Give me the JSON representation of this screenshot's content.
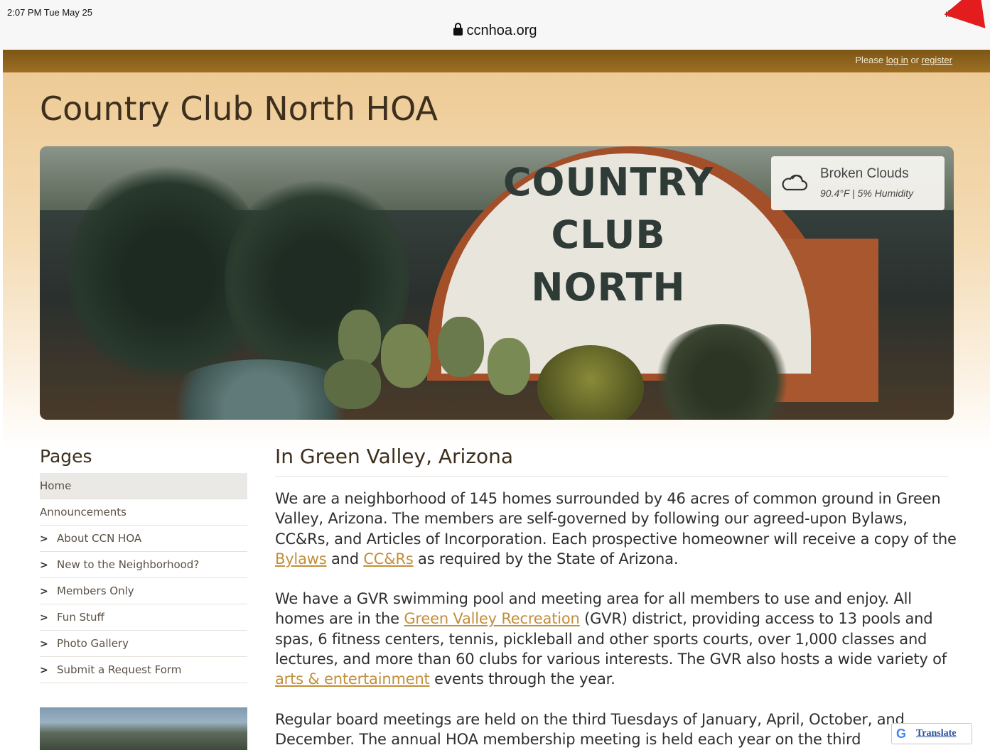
{
  "status_bar": {
    "time": "2:07 PM  Tue May 25",
    "url": "ccnhoa.org",
    "icons": "ıl ᯤ"
  },
  "top_bar": {
    "prefix": "Please ",
    "login_label": "log in",
    "middle": " or ",
    "register_label": "register"
  },
  "site": {
    "title": "Country Club North HOA"
  },
  "hero": {
    "sign_line1": "COUNTRY",
    "sign_line2": "CLUB",
    "sign_line3": "NORTH"
  },
  "weather": {
    "icon": "cloud-icon",
    "condition": "Broken Clouds",
    "detail": "90.4°F | 5% Humidity"
  },
  "sidebar": {
    "heading": "Pages",
    "items": [
      {
        "label": "Home",
        "expandable": false,
        "active": true
      },
      {
        "label": "Announcements",
        "expandable": false,
        "active": false
      },
      {
        "label": "About CCN HOA",
        "expandable": true,
        "active": false
      },
      {
        "label": "New to the Neighborhood?",
        "expandable": true,
        "active": false
      },
      {
        "label": "Members Only",
        "expandable": true,
        "active": false
      },
      {
        "label": "Fun Stuff",
        "expandable": true,
        "active": false
      },
      {
        "label": "Photo Gallery",
        "expandable": true,
        "active": false
      },
      {
        "label": "Submit a Request Form",
        "expandable": true,
        "active": false
      }
    ]
  },
  "main": {
    "heading": "In Green Valley, Arizona",
    "p1_text1": "We are a neighborhood of 145 homes surrounded by 46 acres of common ground in Green Valley, Arizona. The members are self-governed by following our agreed-upon Bylaws, CC&Rs, and Articles of Incorporation. Each prospective homeowner will receive a copy of the ",
    "p1_link1": "Bylaws",
    "p1_text2": " and ",
    "p1_link2": "CC&Rs",
    "p1_text3": " as required by the State of Arizona.",
    "p2_text1": "We have a GVR swimming pool and meeting area for all members to use and enjoy. All homes are in the ",
    "p2_link1": "Green Valley Recreation",
    "p2_text2": " (GVR) district, providing access to 13 pools and spas, 6 fitness centers, tennis, pickleball and other sports courts, over 1,000 classes and lectures, and more than 60 clubs for various interests.  The GVR also hosts a wide variety of ",
    "p2_link2": "arts & entertainment",
    "p2_text3": " events through the year.",
    "p3_text": "Regular board meetings are held on the third Tuesdays of January, April, October, and December. The annual HOA membership meeting is held each year on the third"
  },
  "translate": {
    "g_icon": "G",
    "label": "Translate"
  },
  "colors": {
    "top_bar": "#8a6019",
    "link": "#c28f3a",
    "accent_arrow": "#e31d1d"
  }
}
